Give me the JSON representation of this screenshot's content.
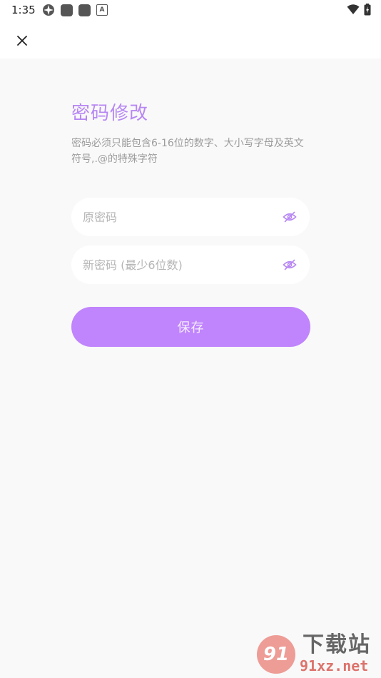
{
  "status_bar": {
    "time": "1:35",
    "notif_letter": "A"
  },
  "page": {
    "title": "密码修改",
    "description": "密码必须只能包含6-16位的数字、大小写字母及英文符号,.@的特殊字符"
  },
  "fields": {
    "old_password": {
      "placeholder": "原密码",
      "value": ""
    },
    "new_password": {
      "placeholder": "新密码 (最少6位数)",
      "value": ""
    }
  },
  "buttons": {
    "save_label": "保存"
  },
  "icons": {
    "close": "close-icon",
    "visibility": "eye-off-icon"
  },
  "colors": {
    "accent": "#b787f3",
    "button": "#c084fc",
    "background": "#f9f9f9"
  },
  "watermark": {
    "logo": "91",
    "text": "下载站",
    "domain": "91xz.net"
  }
}
